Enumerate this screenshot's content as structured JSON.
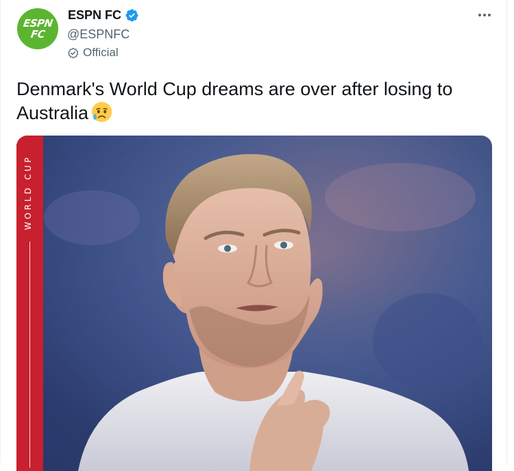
{
  "tweet": {
    "author": {
      "avatar_line1": "ESPN",
      "avatar_line2": "FC",
      "display_name": "ESPN FC",
      "handle": "@ESPNFC",
      "official_label": "Official",
      "verified_icon": "verified-badge-icon",
      "colors": {
        "avatar_bg": "#5cb531",
        "verified": "#1d9bf0"
      }
    },
    "more_icon": "more-options-icon",
    "text": "Denmark's World Cup dreams are over after losing to Australia",
    "emoji": "crying-face-emoji",
    "media": {
      "sidebar_label": "WORLD CUP",
      "colors": {
        "strip": "#c8202e"
      }
    }
  }
}
